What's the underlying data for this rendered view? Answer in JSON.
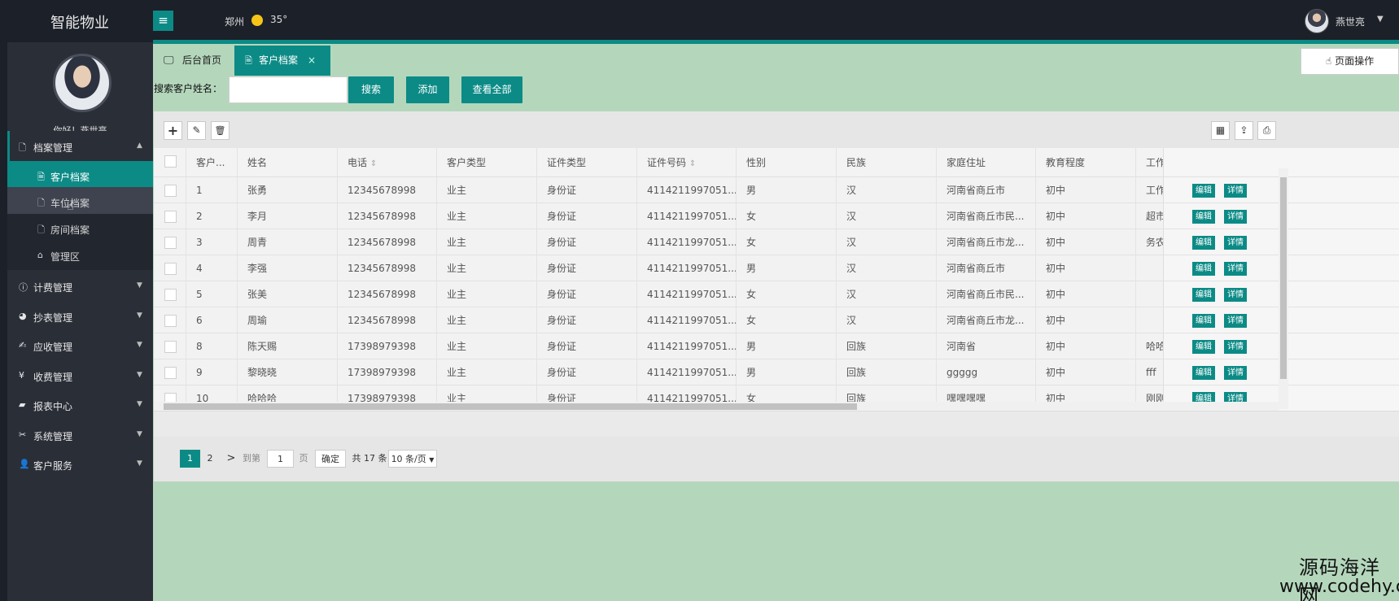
{
  "app": {
    "brand": "智能物业",
    "city": "郑州",
    "temperature": "35°",
    "username": "燕世亮",
    "hamburger_icon": "≡"
  },
  "sidebar": {
    "greeting": "你好！燕世亮",
    "archives": {
      "label": "档案管理",
      "icon": "file-icon"
    },
    "archive_items": [
      {
        "label": "客户档案",
        "icon": "file-icon"
      },
      {
        "label": "车位档案",
        "icon": "file-icon"
      },
      {
        "label": "房间档案",
        "icon": "file-icon"
      },
      {
        "label": "管理区",
        "icon": "home-icon"
      }
    ],
    "menus": [
      {
        "label": "计费管理",
        "icon": "info-icon"
      },
      {
        "label": "抄表管理",
        "icon": "pie-icon"
      },
      {
        "label": "应收管理",
        "icon": "edit-icon"
      },
      {
        "label": "收费管理",
        "icon": "yen-icon"
      },
      {
        "label": "报表中心",
        "icon": "chart-icon"
      },
      {
        "label": "系统管理",
        "icon": "tools-icon"
      },
      {
        "label": "客户服务",
        "icon": "user-icon"
      }
    ]
  },
  "tabs": [
    {
      "label": "后台首页",
      "icon": "monitor-icon"
    },
    {
      "label": "客户档案",
      "icon": "file-icon",
      "close": "×"
    }
  ],
  "page_ops": "页面操作",
  "search": {
    "label": "搜索客户姓名：",
    "value": "",
    "placeholder": "",
    "search_btn": "搜索",
    "add_btn": "添加",
    "viewall_btn": "查看全部"
  },
  "toolbar": {
    "add": "+",
    "edit": "✎",
    "delete": "🗑"
  },
  "table": {
    "columns": [
      "客户...",
      "姓名",
      "电话",
      "客户类型",
      "证件类型",
      "证件号码",
      "性别",
      "民族",
      "家庭住址",
      "教育程度",
      "工作..."
    ],
    "rows": [
      [
        "1",
        "张勇",
        "12345678998",
        "业主",
        "身份证",
        "4114211997051...",
        "男",
        "汉",
        "河南省商丘市",
        "初中",
        "工作..."
      ],
      [
        "2",
        "李月",
        "12345678998",
        "业主",
        "身份证",
        "4114211997051...",
        "女",
        "汉",
        "河南省商丘市民...",
        "初中",
        "超市..."
      ],
      [
        "3",
        "周青",
        "12345678998",
        "业主",
        "身份证",
        "4114211997051...",
        "女",
        "汉",
        "河南省商丘市龙...",
        "初中",
        "务农..."
      ],
      [
        "4",
        "李强",
        "12345678998",
        "业主",
        "身份证",
        "4114211997051...",
        "男",
        "汉",
        "河南省商丘市",
        "初中",
        ""
      ],
      [
        "5",
        "张美",
        "12345678998",
        "业主",
        "身份证",
        "4114211997051...",
        "女",
        "汉",
        "河南省商丘市民...",
        "初中",
        ""
      ],
      [
        "6",
        "周瑜",
        "12345678998",
        "业主",
        "身份证",
        "4114211997051...",
        "女",
        "汉",
        "河南省商丘市龙...",
        "初中",
        ""
      ],
      [
        "8",
        "陈天赐",
        "17398979398",
        "业主",
        "身份证",
        "4114211997051...",
        "男",
        "回族",
        "河南省",
        "初中",
        "哈哈..."
      ],
      [
        "9",
        "黎晓晓",
        "17398979398",
        "业主",
        "身份证",
        "4114211997051...",
        "男",
        "回族",
        "ggggg",
        "初中",
        "fff"
      ],
      [
        "10",
        "哈哈哈",
        "17398979398",
        "业主",
        "身份证",
        "4114211997051...",
        "女",
        "回族",
        "嘿嘿嘿嘿",
        "初中",
        "刚刚..."
      ]
    ],
    "edit_label": "编辑",
    "detail_label": "详情"
  },
  "pager": {
    "page1": "1",
    "page2": "2",
    "next": ">",
    "goto": "到第",
    "page_input": "1",
    "page_unit": "页",
    "confirm": "确定",
    "total": "共 17 条",
    "size": "10 条/页"
  },
  "watermark": {
    "line1": "源码海洋网",
    "line2": "www.codehy.com"
  },
  "colors": {
    "accent": "#0c8b86",
    "main_bg": "#b4d7bc",
    "sidebar_bg": "#2a2e37",
    "topbar_bg": "#1c2029"
  }
}
